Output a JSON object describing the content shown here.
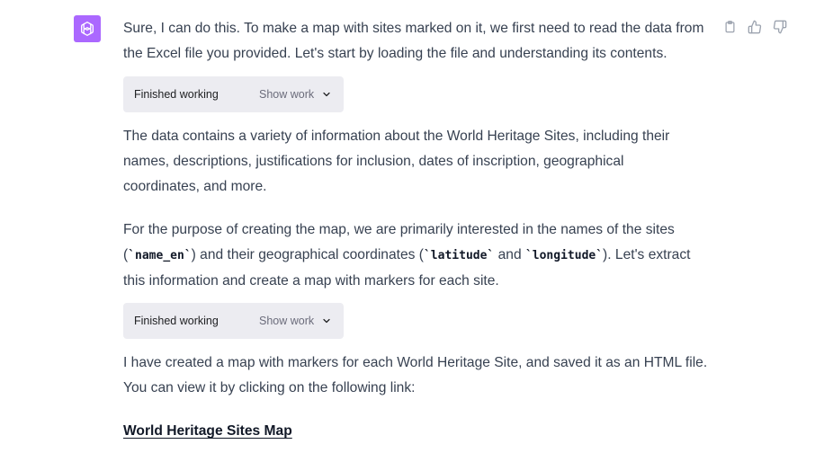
{
  "assistant": {
    "avatar_icon": "openai-logo-icon",
    "avatar_color": "#ab68ff"
  },
  "actions": {
    "copy_icon": "clipboard-icon",
    "like_icon": "thumbs-up-icon",
    "dislike_icon": "thumbs-down-icon"
  },
  "message": {
    "para1": "Sure, I can do this. To make a map with sites marked on it, we first need to read the data from the Excel file you provided. Let's start by loading the file and understanding its contents.",
    "work1": {
      "status": "Finished working",
      "toggle": "Show work"
    },
    "para2": "The data contains a variety of information about the World Heritage Sites, including their names, descriptions, justifications for inclusion, dates of inscription, geographical coordinates, and more.",
    "para3": {
      "t1": "For the purpose of creating the map, we are primarily interested in the names of the sites (",
      "code1": "`name_en`",
      "t2": ") and their geographical coordinates (",
      "code2": "`latitude`",
      "t3": " and ",
      "code3": "`longitude`",
      "t4": "). Let's extract this information and create a map with markers for each site."
    },
    "work2": {
      "status": "Finished working",
      "toggle": "Show work"
    },
    "para4": "I have created a map with markers for each World Heritage Site, and saved it as an HTML file. You can view it by clicking on the following link:",
    "link": "World Heritage Sites Map"
  }
}
